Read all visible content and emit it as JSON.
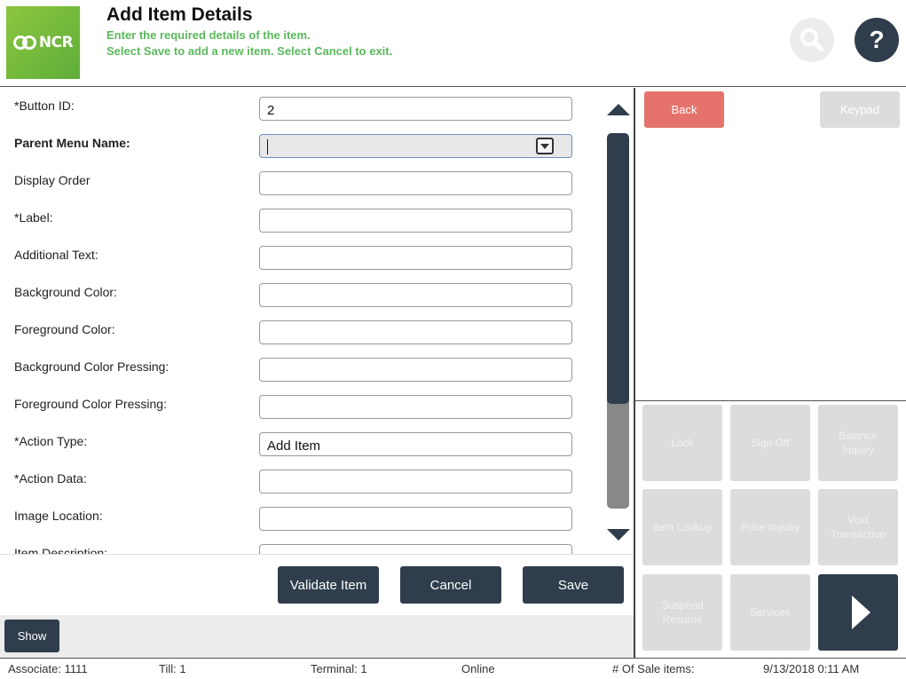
{
  "header": {
    "logo_text": "NCR",
    "title": "Add Item Details",
    "subtitle_line1": "Enter the required details of the item.",
    "subtitle_line2": "Select Save to add a new item. Select Cancel to exit.",
    "help_label": "?",
    "search_icon": "search-icon",
    "help_icon": "help-icon"
  },
  "form": {
    "fields": [
      {
        "label": "*Button ID:",
        "value": "2"
      },
      {
        "label": "Parent Menu Name:",
        "value": ""
      },
      {
        "label": "Display Order",
        "value": ""
      },
      {
        "label": "*Label:",
        "value": ""
      },
      {
        "label": "Additional Text:",
        "value": ""
      },
      {
        "label": "Background Color:",
        "value": ""
      },
      {
        "label": "Foreground Color:",
        "value": ""
      },
      {
        "label": "Background Color Pressing:",
        "value": ""
      },
      {
        "label": "Foreground Color Pressing:",
        "value": ""
      },
      {
        "label": "*Action Type:",
        "value": "Add Item"
      },
      {
        "label": "*Action Data:",
        "value": ""
      },
      {
        "label": "Image Location:",
        "value": ""
      },
      {
        "label": "Item Description:",
        "value": ""
      }
    ],
    "scroll_position": 0.72
  },
  "actions": {
    "validate": "Validate Item",
    "cancel": "Cancel",
    "save": "Save",
    "show": "Show"
  },
  "right_panel": {
    "back": "Back",
    "keypad": "Keypad",
    "grid": [
      "Lock",
      "Sign Off",
      "Balance Inquiry",
      "Item Lookup",
      "Price Inquiry",
      "Void Transaction",
      "Suspend Resume",
      "Services"
    ],
    "next_icon": "chevron-right-icon"
  },
  "status": {
    "associate": "Associate: 1111",
    "till": "Till: 1",
    "terminal": "Terminal: 1",
    "online": "Online",
    "sale_items": "# Of Sale items:",
    "datetime": "9/13/2018 0:11 AM"
  },
  "colors": {
    "dark_button": "#2f3d4c",
    "back_button": "#e5736b",
    "brand_green": "#5fae3a",
    "subtitle_green": "#5cb85c",
    "disabled_button": "#dcdcdc"
  }
}
